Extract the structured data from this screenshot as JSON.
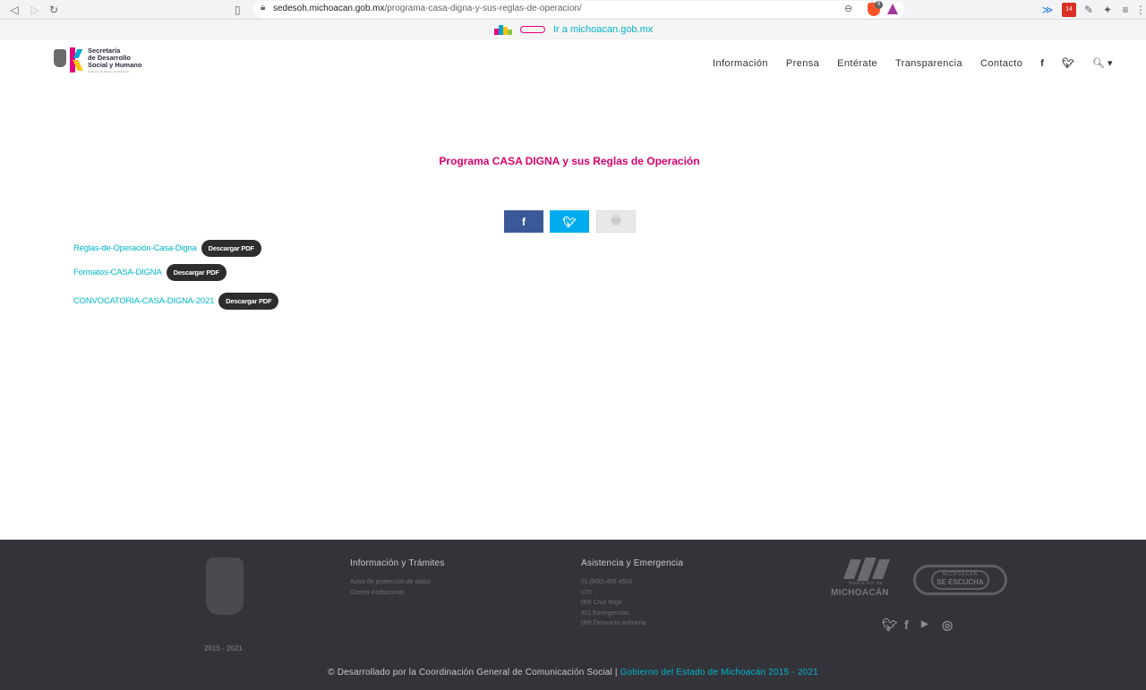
{
  "browser": {
    "url_domain": "sedesoh.michoacan.gob.mx",
    "url_path": "/programa-casa-digna-y-sus-reglas-de-operacion/",
    "brave_badge": "9",
    "ext_badge": "14"
  },
  "topbar": {
    "link_label": "Ir a michoacan.gob.mx"
  },
  "header": {
    "logo_line1": "Secretaría",
    "logo_line2": "de Desarrollo",
    "logo_line3": "Social y Humano",
    "logo_tagline": "Gobierno del Estado de Michoacán",
    "menu": [
      {
        "label": "Información"
      },
      {
        "label": "Prensa"
      },
      {
        "label": "Entérate"
      },
      {
        "label": "Transparencia"
      },
      {
        "label": "Contacto"
      }
    ]
  },
  "main": {
    "title": "Programa CASA DIGNA y sus Reglas de Operación",
    "downloads": [
      {
        "label": "Reglas-de-Operación-Casa-Digna",
        "button": "Descargar PDF"
      },
      {
        "label": "Formatos-CASA-DIGNA",
        "button": "Descargar PDF"
      },
      {
        "label": "CONVOCATORIA-CASA-DIGNA-2021",
        "button": "Descargar PDF"
      }
    ]
  },
  "footer": {
    "years": "2015 - 2021",
    "col1": {
      "heading": "Información y Trámites",
      "items": [
        "Aviso de protección de datos",
        "Correo institucional"
      ]
    },
    "col2": {
      "heading": "Asistencia y Emergencia",
      "items": [
        "01 (800) 455 4500",
        "070",
        "065 Cruz Roja",
        "911 Emergencias",
        "089 Denuncia anónima"
      ]
    },
    "gob_logo_small": "Gobierno de",
    "gob_logo_name": "MICHOACÁN",
    "escucha_top": "MICHOACÁN",
    "escucha_main": "SE ESCUCHA",
    "copyright_text": "© Desarrollado por la Coordinación General de Comunicación Social |",
    "copyright_link": "Gobierno del Estado de Michoacán 2015 - 2021"
  }
}
